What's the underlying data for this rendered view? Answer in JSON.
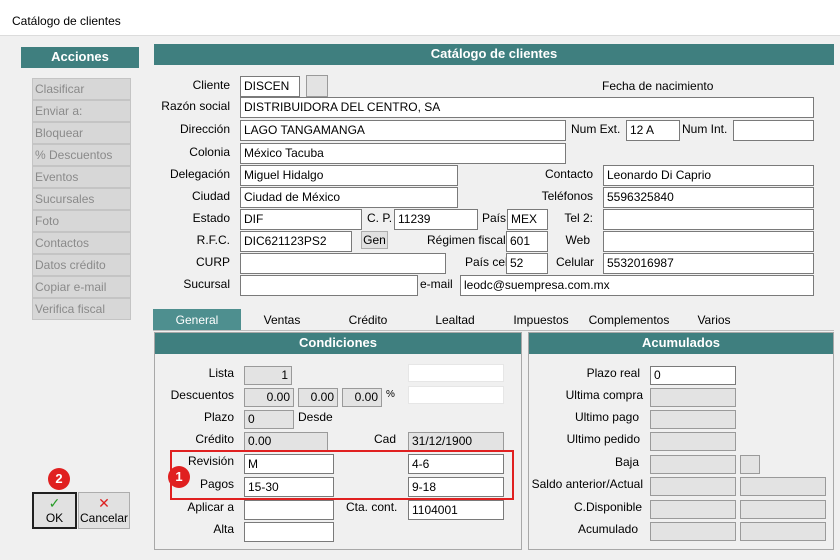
{
  "window": {
    "title": "Catálogo de clientes"
  },
  "actions": {
    "header": "Acciones",
    "items": [
      "Clasificar",
      "Enviar a:",
      "Bloquear",
      "% Descuentos",
      "Eventos",
      "Sucursales",
      "Foto",
      "Contactos",
      "Datos crédito",
      "Copiar e-mail",
      "Verifica fiscal"
    ]
  },
  "catalog": {
    "header": "Catálogo de clientes",
    "labels": {
      "cliente": "Cliente",
      "fecha_nacimiento": "Fecha de nacimiento",
      "razon_social": "Razón social",
      "direccion": "Dirección",
      "num_ext": "Num Ext.",
      "num_int": "Num Int.",
      "colonia": "Colonia",
      "delegacion": "Delegación",
      "contacto": "Contacto",
      "ciudad": "Ciudad",
      "telefonos": "Teléfonos",
      "estado": "Estado",
      "cp": "C. P.",
      "pais": "País",
      "tel2": "Tel 2:",
      "rfc": "R.F.C.",
      "gen": "Gen",
      "regimen_fiscal": "Régimen fiscal",
      "web": "Web",
      "curp": "CURP",
      "pais_cel": "País cel",
      "celular": "Celular",
      "sucursal": "Sucursal",
      "email": "e-mail"
    },
    "values": {
      "cliente": "DISCEN",
      "razon_social": "DISTRIBUIDORA DEL CENTRO, SA",
      "direccion": "LAGO TANGAMANGA",
      "num_ext": "12 A",
      "num_int": "",
      "colonia": "México Tacuba",
      "delegacion": "Miguel Hidalgo",
      "contacto": "Leonardo Di Caprio",
      "ciudad": "Ciudad de México",
      "telefonos": "5596325840",
      "estado": "DIF",
      "cp": "11239",
      "pais": "MEX",
      "tel2": "",
      "rfc": "DIC621123PS2",
      "regimen_fiscal": "601",
      "web": "",
      "curp": "",
      "pais_cel": "52",
      "celular": "5532016987",
      "sucursal": "",
      "email": "leodc@suempresa.com.mx"
    }
  },
  "tabs": [
    "General",
    "Ventas",
    "Crédito",
    "Lealtad",
    "Impuestos",
    "Complementos",
    "Varios"
  ],
  "condiciones": {
    "header": "Condiciones",
    "labels": {
      "lista": "Lista",
      "descuentos": "Descuentos",
      "percent": "%",
      "plazo": "Plazo",
      "desde": "Desde",
      "credito": "Crédito",
      "cad": "Cad",
      "revision": "Revisión",
      "pagos": "Pagos",
      "aplicar_a": "Aplicar a",
      "cta_cont": "Cta. cont.",
      "alta": "Alta"
    },
    "values": {
      "lista": "1",
      "desc1": "0.00",
      "desc2": "0.00",
      "desc3": "0.00",
      "plazo": "0",
      "credito": "0.00",
      "cad": "31/12/1900",
      "revision": "M",
      "revision_right": "4-6",
      "pagos": "15-30",
      "pagos_right": "9-18",
      "aplicar_a": "",
      "cta_cont": "1104001",
      "alta": ""
    }
  },
  "acumulados": {
    "header": "Acumulados",
    "labels": {
      "plazo_real": "Plazo real",
      "ultima_compra": "Ultima compra",
      "ultimo_pago": "Ultimo pago",
      "ultimo_pedido": "Ultimo pedido",
      "baja": "Baja",
      "saldo": "Saldo anterior/Actual",
      "c_disponible": "C.Disponible",
      "acumulado": "Acumulado"
    },
    "values": {
      "plazo_real": "0"
    }
  },
  "buttons": {
    "ok": "OK",
    "cancelar": "Cancelar"
  },
  "badges": {
    "one": "1",
    "two": "2"
  },
  "colors": {
    "header_bg": "#3f7f7f",
    "tab_selected": "#4e8f8f",
    "highlight": "#e02020"
  }
}
